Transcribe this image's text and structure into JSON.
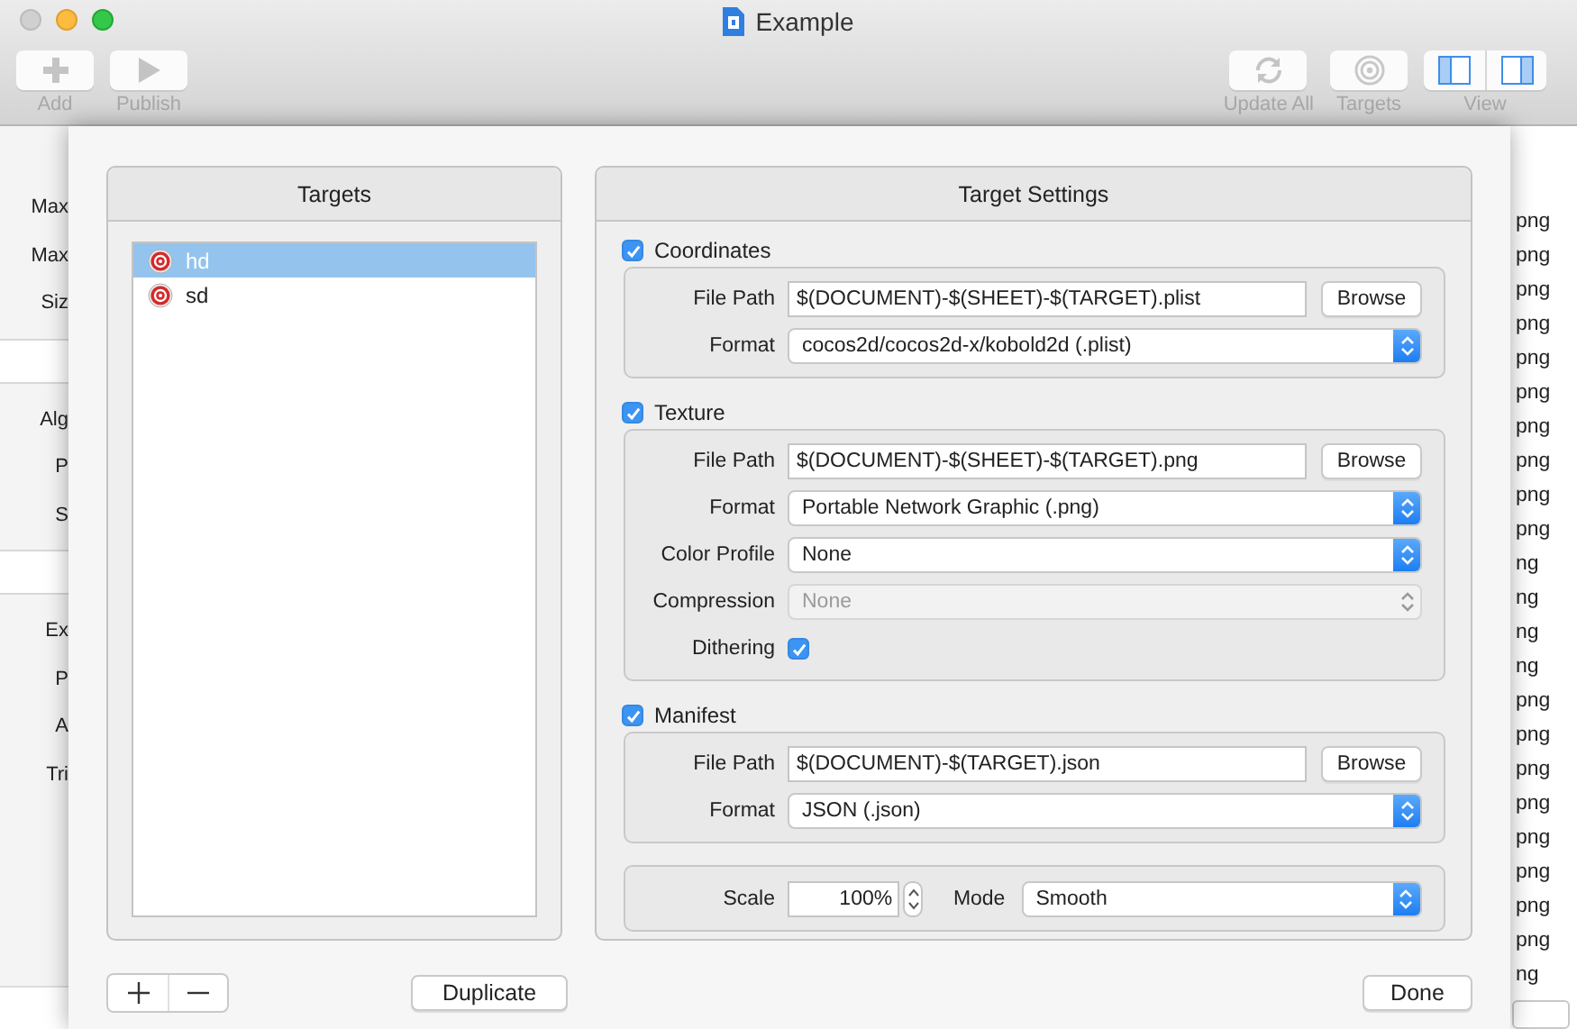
{
  "window": {
    "title": "Example"
  },
  "toolbar": {
    "left": [
      {
        "kind": "add",
        "label": "Add"
      },
      {
        "kind": "publish",
        "label": "Publish"
      }
    ],
    "right": [
      {
        "kind": "update",
        "label": "Update All"
      },
      {
        "kind": "targets",
        "label": "Targets"
      },
      {
        "kind": "view",
        "label": "View",
        "panes": [
          {
            "on": true
          },
          {
            "on": true
          }
        ]
      }
    ]
  },
  "background_form": {
    "groups": [
      {
        "labels": [
          "Max",
          "Max",
          "Siz"
        ]
      },
      {
        "labels": [
          "Alg",
          "P",
          "S"
        ]
      },
      {
        "labels": [
          "Ex",
          "P",
          "A",
          "Tri"
        ]
      }
    ]
  },
  "background_list": {
    "cells": [
      "png",
      "png",
      "png",
      "png",
      "png",
      "png",
      "png",
      "png",
      "png",
      "png",
      "ng",
      "ng",
      "ng",
      "ng",
      "png",
      "png",
      "png",
      "png",
      "png",
      "png",
      "png",
      "png",
      "ng"
    ]
  },
  "targets_panel": {
    "title": "Targets",
    "items": [
      {
        "name": "hd",
        "selected": true
      },
      {
        "name": "sd",
        "selected": false
      }
    ],
    "duplicate_button": "Duplicate"
  },
  "settings_panel": {
    "title": "Target Settings",
    "sections": [
      {
        "label": "Coordinates",
        "checked": true,
        "rows": [
          {
            "kind": "path",
            "label": "File Path",
            "value": "$(DOCUMENT)-$(SHEET)-$(TARGET).plist",
            "button": "Browse"
          },
          {
            "kind": "select",
            "label": "Format",
            "value": "cocos2d/cocos2d-x/kobold2d (.plist)",
            "disabled": false
          }
        ]
      },
      {
        "label": "Texture",
        "checked": true,
        "rows": [
          {
            "kind": "path",
            "label": "File Path",
            "value": "$(DOCUMENT)-$(SHEET)-$(TARGET).png",
            "button": "Browse"
          },
          {
            "kind": "select",
            "label": "Format",
            "value": "Portable Network Graphic (.png)",
            "disabled": false
          },
          {
            "kind": "select",
            "label": "Color Profile",
            "value": "None",
            "disabled": false
          },
          {
            "kind": "select",
            "label": "Compression",
            "value": "None",
            "disabled": true
          },
          {
            "kind": "check",
            "label": "Dithering",
            "checked": true
          }
        ]
      },
      {
        "label": "Manifest",
        "checked": true,
        "rows": [
          {
            "kind": "path",
            "label": "File Path",
            "value": "$(DOCUMENT)-$(TARGET).json",
            "button": "Browse"
          },
          {
            "kind": "select",
            "label": "Format",
            "value": "JSON (.json)",
            "disabled": false
          }
        ]
      }
    ],
    "scale_box": {
      "scale_label": "Scale",
      "scale_value": "100%",
      "mode_label": "Mode",
      "mode_value": "Smooth"
    }
  },
  "done_button": "Done"
}
